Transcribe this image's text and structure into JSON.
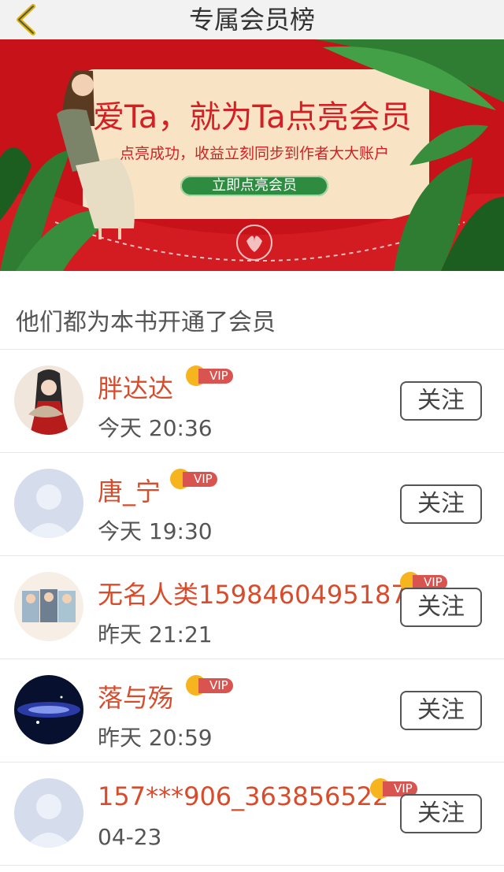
{
  "header": {
    "title": "专属会员榜"
  },
  "banner": {
    "headline": "爱Ta，就为Ta点亮会员",
    "subtitle": "点亮成功，收益立刻同步到作者大大账户",
    "cta_label": "立即点亮会员"
  },
  "section": {
    "title": "他们都为本书开通了会员"
  },
  "members": [
    {
      "name": "胖达达",
      "vip": "VIP",
      "time": "今天 20:36",
      "follow": "关注"
    },
    {
      "name": "唐_宁",
      "vip": "VIP",
      "time": "今天 19:30",
      "follow": "关注"
    },
    {
      "name": "无名人类1598460495187",
      "vip": "VIP",
      "time": "昨天 21:21",
      "follow": "关注"
    },
    {
      "name": "落与殇",
      "vip": "VIP",
      "time": "昨天 20:59",
      "follow": "关注"
    },
    {
      "name": "157***906_363856522",
      "vip": "VIP",
      "time": "04-23",
      "follow": "关注"
    }
  ],
  "colors": {
    "accent": "#d84c2c",
    "banner_red": "#c8121a",
    "vip_tag": "#d9534f",
    "crown": "#f6b41f"
  }
}
